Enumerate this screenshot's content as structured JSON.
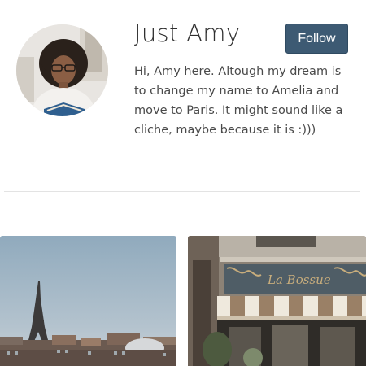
{
  "profile": {
    "name": "Just Amy",
    "follow_label": "Follow",
    "bio": "Hi, Amy here. Altough my dream is to change my name to Amelia and move to Paris. It might sound like a cliche, maybe because it is :)))"
  },
  "gallery": {
    "right_photo_sign": "La Bossue"
  },
  "colors": {
    "follow_button": "#3d5a73",
    "divider": "#e3e3e3"
  }
}
